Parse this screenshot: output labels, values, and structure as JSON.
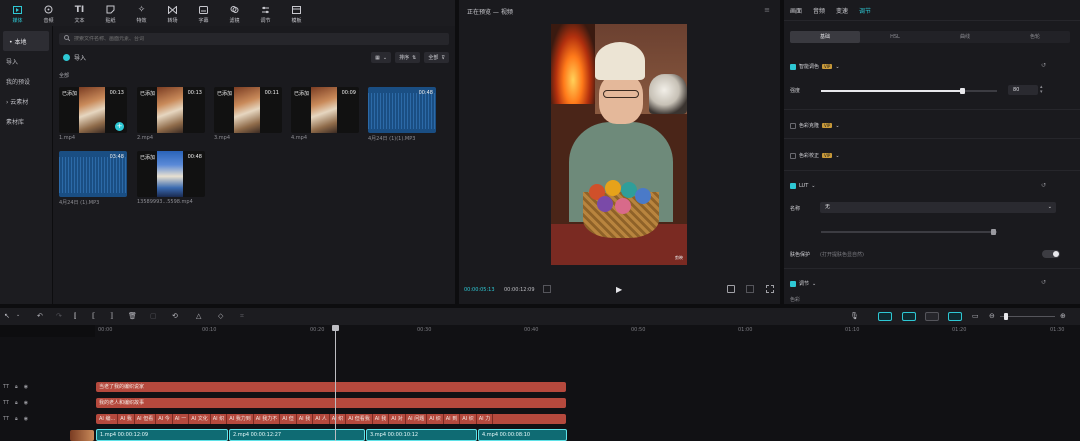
{
  "toolbar": {
    "tools": [
      {
        "label": "媒体",
        "icon": "media-icon"
      },
      {
        "label": "音频",
        "icon": "audio-icon"
      },
      {
        "label": "文本",
        "icon": "text-icon"
      },
      {
        "label": "贴纸",
        "icon": "sticker-icon"
      },
      {
        "label": "特效",
        "icon": "effects-icon"
      },
      {
        "label": "转场",
        "icon": "transition-icon"
      },
      {
        "label": "字幕",
        "icon": "caption-icon"
      },
      {
        "label": "滤镜",
        "icon": "filter-icon"
      },
      {
        "label": "调节",
        "icon": "adjust-icon"
      },
      {
        "label": "模板",
        "icon": "template-icon"
      }
    ]
  },
  "sidebar": {
    "items": [
      {
        "label": "• 本地"
      },
      {
        "label": "导入"
      },
      {
        "label": "我的预设"
      },
      {
        "label": "› 云素材"
      },
      {
        "label": "素材库"
      }
    ]
  },
  "media": {
    "search_placeholder": "搜索文件名称、画面元素、台词",
    "import_label": "导入",
    "sort_label": "排序",
    "filter_label": "全部",
    "section_label": "全部",
    "items": [
      {
        "tag": "已添加",
        "duration": "00:13",
        "name": "1.mp4"
      },
      {
        "tag": "已添加",
        "duration": "00:13",
        "name": "2.mp4"
      },
      {
        "tag": "已添加",
        "duration": "00:11",
        "name": "3.mp4"
      },
      {
        "tag": "已添加",
        "duration": "00:09",
        "name": "4.mp4"
      },
      {
        "tag": "",
        "duration": "00:48",
        "name": "4月24日 (1)(1).MP3"
      },
      {
        "tag": "",
        "duration": "03:48",
        "name": "4月24日 (1).MP3"
      },
      {
        "tag": "已添加",
        "duration": "00:48",
        "name": "13589993...5598.mp4"
      }
    ]
  },
  "preview": {
    "title": "正在预览 — 视频",
    "current_time": "00:00:05:13",
    "total_time": "00:00:12:09",
    "watermark": "剪映",
    "menu_icon": "menu-icon"
  },
  "inspector": {
    "tabs": [
      "画面",
      "音频",
      "变速",
      "调节"
    ],
    "active_tab": "调节",
    "subtabs": [
      "基础",
      "HSL",
      "曲线",
      "色轮"
    ],
    "smart_color": {
      "label": "智能调色",
      "vip": "VIP",
      "strength_label": "强度",
      "strength_value": "80",
      "strength_fraction": 0.8
    },
    "color_correction": {
      "label": "色彩克隆",
      "vip": "VIP"
    },
    "color_calibration": {
      "label": "色彩校正",
      "vip": "VIP"
    },
    "lut": {
      "label": "LUT",
      "name_label": "名称",
      "name_value": "无"
    },
    "skin_protect": {
      "label": "肤色保护",
      "hint": "(打开提肤色显自然)"
    },
    "adjust": {
      "label": "调节",
      "sub_label": "色彩"
    }
  },
  "timeline": {
    "ticks": [
      "00:00",
      "00:10",
      "00:20",
      "00:30",
      "00:40",
      "00:50",
      "01:00",
      "01:10",
      "01:20",
      "01:30"
    ],
    "track_heads": [
      {
        "label": "TT"
      },
      {
        "label": "TT"
      },
      {
        "label": "TT"
      }
    ],
    "text_clips": [
      {
        "label": "当老了我的编织说家"
      },
      {
        "label": "我的老人和编织故事"
      }
    ],
    "caption_segments": [
      "AI 编...",
      "AI 我",
      "AI 但看",
      "AI 今",
      "AI 一",
      "AI 文化",
      "AI 织",
      "AI 我力到",
      "AI 我力不",
      "AI 但",
      "AI 我",
      "AI 人",
      "AI 织",
      "AI 但看我",
      "AI 我",
      "AI 对",
      "AI 问题",
      "AI 织",
      "AI 到",
      "AI 织",
      "AI 力"
    ],
    "video_clips": [
      {
        "label": "1.mp4  00:00:12:09"
      },
      {
        "label": "2.mp4  00:00:12:27"
      },
      {
        "label": "3.mp4  00:00:10:12"
      },
      {
        "label": "4.mp4  00:00:08:10"
      }
    ]
  },
  "colors": {
    "accent": "#2ec8d4",
    "caption_clip": "#b5493d",
    "video_clip": "#0f6b73",
    "vip": "#c99a3a"
  }
}
